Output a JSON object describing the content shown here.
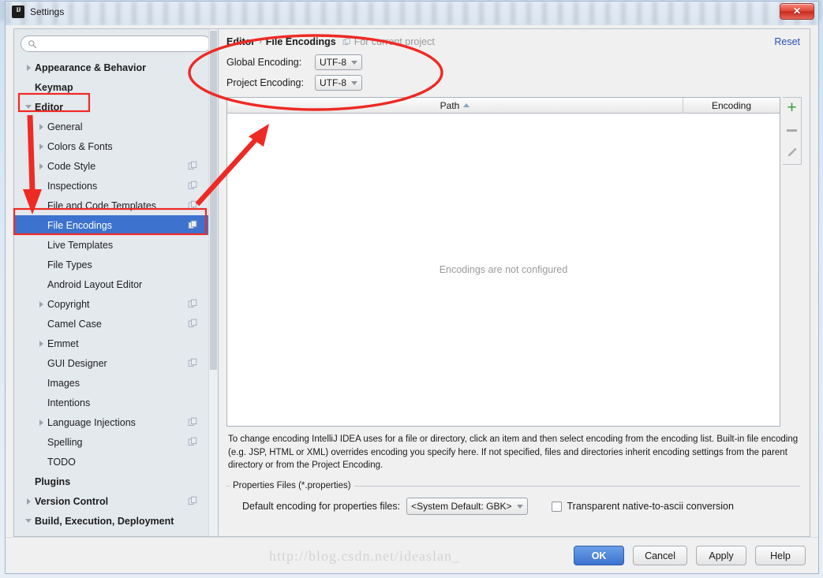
{
  "window": {
    "title": "Settings",
    "logo_icon": "intellij-idea-logo",
    "close_label": "✕"
  },
  "sidebar": {
    "search": {
      "placeholder": "",
      "value": "",
      "icon": "search-icon"
    },
    "items": [
      {
        "label": "Appearance & Behavior",
        "level": 0,
        "bold": true,
        "arrow": "collapsed",
        "copy": false,
        "selected": false
      },
      {
        "label": "Keymap",
        "level": 0,
        "bold": true,
        "arrow": "none",
        "copy": false,
        "selected": false
      },
      {
        "label": "Editor",
        "level": 0,
        "bold": true,
        "arrow": "expanded",
        "copy": false,
        "selected": false
      },
      {
        "label": "General",
        "level": 1,
        "bold": false,
        "arrow": "collapsed",
        "copy": false,
        "selected": false
      },
      {
        "label": "Colors & Fonts",
        "level": 1,
        "bold": false,
        "arrow": "collapsed",
        "copy": false,
        "selected": false
      },
      {
        "label": "Code Style",
        "level": 1,
        "bold": false,
        "arrow": "collapsed",
        "copy": true,
        "selected": false
      },
      {
        "label": "Inspections",
        "level": 1,
        "bold": false,
        "arrow": "none",
        "copy": true,
        "selected": false
      },
      {
        "label": "File and Code Templates",
        "level": 1,
        "bold": false,
        "arrow": "none",
        "copy": true,
        "selected": false
      },
      {
        "label": "File Encodings",
        "level": 1,
        "bold": false,
        "arrow": "none",
        "copy": true,
        "selected": true
      },
      {
        "label": "Live Templates",
        "level": 1,
        "bold": false,
        "arrow": "none",
        "copy": false,
        "selected": false
      },
      {
        "label": "File Types",
        "level": 1,
        "bold": false,
        "arrow": "none",
        "copy": false,
        "selected": false
      },
      {
        "label": "Android Layout Editor",
        "level": 1,
        "bold": false,
        "arrow": "none",
        "copy": false,
        "selected": false
      },
      {
        "label": "Copyright",
        "level": 1,
        "bold": false,
        "arrow": "collapsed",
        "copy": true,
        "selected": false
      },
      {
        "label": "Camel Case",
        "level": 1,
        "bold": false,
        "arrow": "none",
        "copy": true,
        "selected": false
      },
      {
        "label": "Emmet",
        "level": 1,
        "bold": false,
        "arrow": "collapsed",
        "copy": false,
        "selected": false
      },
      {
        "label": "GUI Designer",
        "level": 1,
        "bold": false,
        "arrow": "none",
        "copy": true,
        "selected": false
      },
      {
        "label": "Images",
        "level": 1,
        "bold": false,
        "arrow": "none",
        "copy": false,
        "selected": false
      },
      {
        "label": "Intentions",
        "level": 1,
        "bold": false,
        "arrow": "none",
        "copy": false,
        "selected": false
      },
      {
        "label": "Language Injections",
        "level": 1,
        "bold": false,
        "arrow": "collapsed",
        "copy": true,
        "selected": false
      },
      {
        "label": "Spelling",
        "level": 1,
        "bold": false,
        "arrow": "none",
        "copy": true,
        "selected": false
      },
      {
        "label": "TODO",
        "level": 1,
        "bold": false,
        "arrow": "none",
        "copy": false,
        "selected": false
      },
      {
        "label": "Plugins",
        "level": 0,
        "bold": true,
        "arrow": "none",
        "copy": false,
        "selected": false
      },
      {
        "label": "Version Control",
        "level": 0,
        "bold": true,
        "arrow": "collapsed",
        "copy": true,
        "selected": false
      },
      {
        "label": "Build, Execution, Deployment",
        "level": 0,
        "bold": true,
        "arrow": "expanded",
        "copy": false,
        "selected": false
      }
    ]
  },
  "content": {
    "breadcrumb": {
      "parent": "Editor",
      "separator": "›",
      "current": "File Encodings",
      "note": "For current project",
      "note_icon": "copy-scope-icon"
    },
    "reset_label": "Reset",
    "encodings": [
      {
        "label": "Global Encoding:",
        "value": "UTF-8"
      },
      {
        "label": "Project Encoding:",
        "value": "UTF-8"
      }
    ],
    "table": {
      "columns": [
        "Path",
        "Encoding"
      ],
      "sort_column": "Path",
      "sort_direction": "ascending",
      "rows": [],
      "empty_text": "Encodings are not configured"
    },
    "table_tools": [
      {
        "name": "add-encoding-button",
        "icon": "plus-icon",
        "glyph": "+"
      },
      {
        "name": "remove-encoding-button",
        "icon": "minus-icon",
        "glyph": "−"
      },
      {
        "name": "edit-encoding-button",
        "icon": "pencil-icon",
        "glyph": "✎"
      }
    ],
    "help_text": "To change encoding IntelliJ IDEA uses for a file or directory, click an item and then select encoding from the encoding list. Built-in file encoding (e.g. JSP, HTML or XML) overrides encoding you specify here. If not specified, files and directories inherit encoding settings from the parent directory or from the Project Encoding.",
    "properties_group": {
      "title": "Properties Files (*.properties)",
      "default_encoding_label": "Default encoding for properties files:",
      "default_encoding_value": "<System Default: GBK>",
      "transparent_label": "Transparent native-to-ascii conversion",
      "transparent_checked": false
    }
  },
  "footer": {
    "watermark": "http://blog.csdn.net/ideaslan_",
    "buttons": [
      {
        "label": "OK",
        "primary": true
      },
      {
        "label": "Cancel",
        "primary": false
      },
      {
        "label": "Apply",
        "primary": false
      },
      {
        "label": "Help",
        "primary": false
      }
    ]
  },
  "annotations": {
    "color": "#ee2a24",
    "items": [
      {
        "type": "ellipse",
        "name": "encoding-fields-highlight"
      },
      {
        "type": "rectangle",
        "name": "editor-node-highlight"
      },
      {
        "type": "rectangle",
        "name": "file-encodings-node-highlight"
      },
      {
        "type": "arrow",
        "name": "editor-down-arrow"
      },
      {
        "type": "arrow",
        "name": "file-encodings-to-fields-arrow"
      }
    ]
  }
}
